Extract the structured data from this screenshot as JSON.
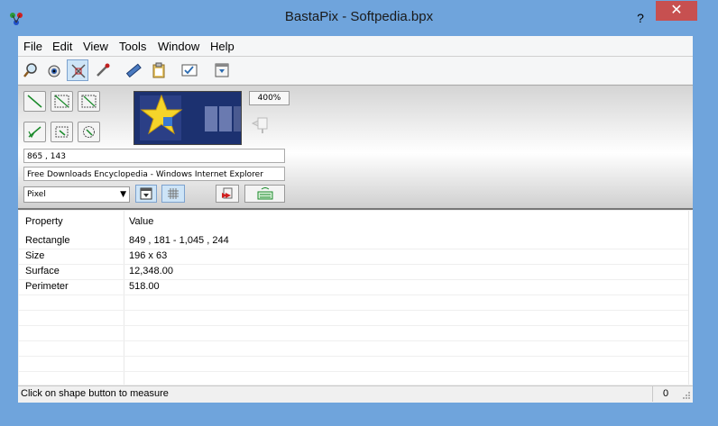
{
  "window": {
    "title": "BastaPix - Softpedia.bpx",
    "help_label": "?",
    "close_label": "✕"
  },
  "menu": {
    "items": [
      "File",
      "Edit",
      "View",
      "Tools",
      "Window",
      "Help"
    ]
  },
  "toolbar": {
    "icons": [
      "magnifier-icon",
      "eye-icon",
      "crosshair-icon",
      "eyedropper-icon",
      "ruler-icon",
      "clipboard-icon",
      "checklist-icon",
      "window-capture-icon"
    ],
    "active_index": 2
  },
  "panel": {
    "zoom": "400%",
    "coordinates": "865 , 143",
    "window_caption": "Free Downloads Encyclopedia - Windows Internet Explorer",
    "unit": "Pixel"
  },
  "table": {
    "headers": {
      "property": "Property",
      "value": "Value"
    },
    "rows": [
      {
        "property": "Rectangle",
        "value": "849 , 181 - 1,045 , 244"
      },
      {
        "property": "Size",
        "value": "196 x 63"
      },
      {
        "property": "Surface",
        "value": "12,348.00"
      },
      {
        "property": "Perimeter",
        "value": "518.00"
      }
    ]
  },
  "status": {
    "message": "Click on shape button to measure",
    "count": "0"
  },
  "colors": {
    "titlebar": "#6fa4dc",
    "close": "#c75050",
    "accent_active": "#cde4f7"
  }
}
